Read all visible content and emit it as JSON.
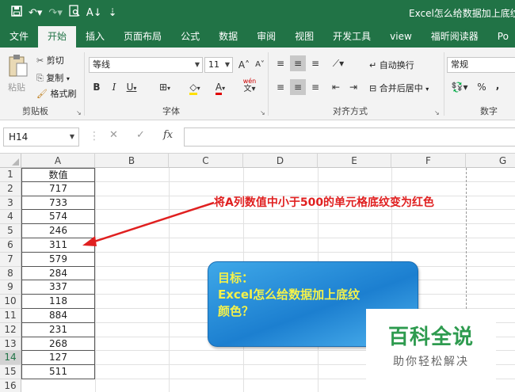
{
  "window": {
    "doc_title": "Excel怎么给数据加上底纹颜",
    "qat_icons": [
      "save-icon",
      "undo-icon",
      "redo-icon",
      "print-preview-icon",
      "sort-icon",
      "customize-icon"
    ]
  },
  "tabs": [
    "文件",
    "开始",
    "插入",
    "页面布局",
    "公式",
    "数据",
    "审阅",
    "视图",
    "开发工具",
    "view",
    "福昕阅读器",
    "Po"
  ],
  "active_tab": "开始",
  "ribbon": {
    "clipboard": {
      "paste": "粘贴",
      "cut": "剪切",
      "copy": "复制",
      "format_painter": "格式刷",
      "label": "剪贴板"
    },
    "font": {
      "name": "等线",
      "size": "11",
      "grow": "A",
      "shrink": "A",
      "bold": "B",
      "italic": "I",
      "underline": "U",
      "font_color_letter": "A",
      "phonetic": "wén",
      "label": "字体"
    },
    "alignment": {
      "wrap_text": "自动换行",
      "merge_center": "合并后居中",
      "label": "对齐方式"
    },
    "number": {
      "format": "常规",
      "percent": "%",
      "comma": ",",
      "label": "数字"
    }
  },
  "formula_bar": {
    "cell_ref": "H14",
    "cancel": "✕",
    "enter": "✓",
    "fx": "fx",
    "value": ""
  },
  "columns": [
    "A",
    "B",
    "C",
    "D",
    "E",
    "F",
    "G"
  ],
  "rows": [
    "1",
    "2",
    "3",
    "4",
    "5",
    "6",
    "7",
    "8",
    "9",
    "10",
    "11",
    "12",
    "13",
    "14",
    "15",
    "16"
  ],
  "selected_row": "14",
  "column_a": [
    "数值",
    "717",
    "733",
    "574",
    "246",
    "311",
    "579",
    "284",
    "337",
    "118",
    "884",
    "231",
    "268",
    "127",
    "511",
    ""
  ],
  "annotation": "将A列数值中小于500的单元格底纹变为红色",
  "goal_box": {
    "line1": "目标：",
    "line2": "Excel怎么给数据加上底纹",
    "line3": "颜色？"
  },
  "watermark": {
    "main": "百科全说",
    "sub": "助你轻松解决"
  },
  "colors": {
    "excel_green": "#217346",
    "annotation_red": "#e02020",
    "goal_text": "#f5f24a",
    "watermark_green": "#2e9b4f"
  }
}
